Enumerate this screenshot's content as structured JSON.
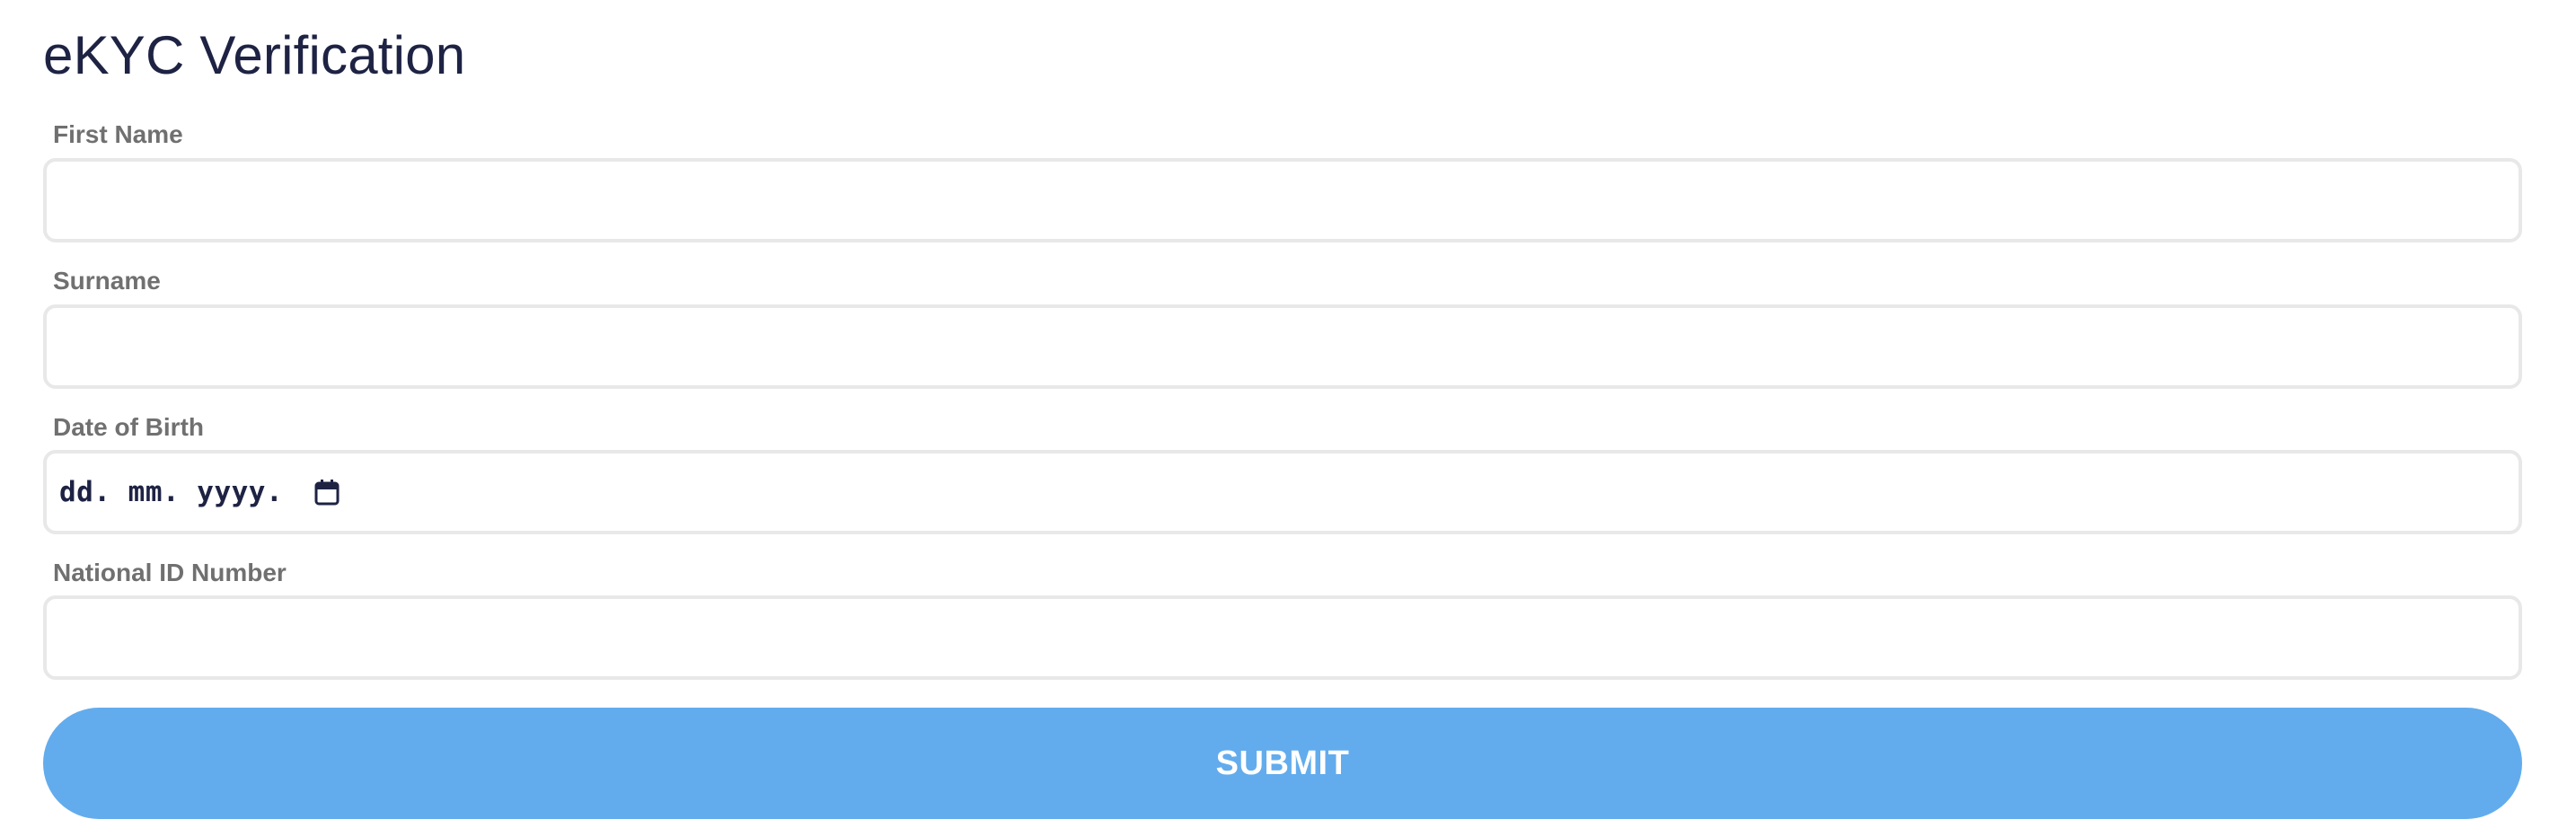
{
  "page": {
    "title": "eKYC Verification"
  },
  "form": {
    "first_name": {
      "label": "First Name",
      "value": "",
      "placeholder": ""
    },
    "surname": {
      "label": "Surname",
      "value": "",
      "placeholder": ""
    },
    "date_of_birth": {
      "label": "Date of Birth",
      "format_text": "dd. mm. yyyy.",
      "icon": "calendar-icon"
    },
    "national_id": {
      "label": "National ID Number",
      "value": "",
      "placeholder": ""
    },
    "submit_label": "SUBMIT"
  },
  "colors": {
    "title_text": "#1e2344",
    "label_text": "#707070",
    "input_border": "#e8e8e8",
    "submit_background": "#62aced",
    "submit_text": "#ffffff"
  }
}
